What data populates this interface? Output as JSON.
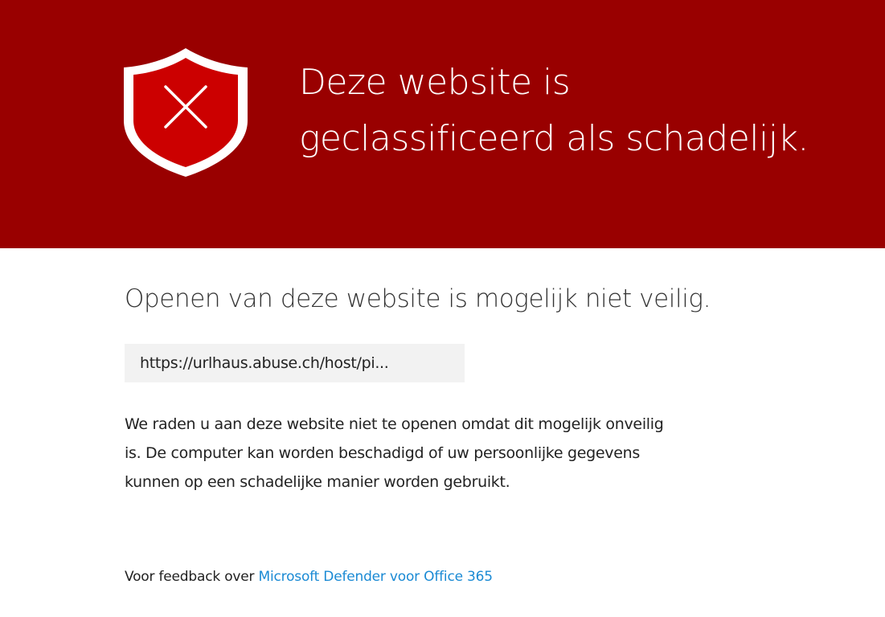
{
  "banner": {
    "background_color": "#990000",
    "icon": "shield-x-icon",
    "headline_line1": "Deze website is",
    "headline_line2": "geclassificeerd als schadelijk."
  },
  "main": {
    "subtitle": "Openen van deze website is mogelijk niet veilig.",
    "url": "https://urlhaus.abuse.ch/host/pi...",
    "description_line1": "We raden u aan deze website niet te openen omdat dit mogelijk onveilig",
    "description_line2": "is. De computer kan worden beschadigd of uw persoonlijke gegevens",
    "description_line3": "kunnen op een schadelijke manier worden gebruikt."
  },
  "footer": {
    "feedback_prefix": "Voor feedback over",
    "feedback_link": "Microsoft Defender voor Office 365",
    "link_color": "#1a8ad4"
  }
}
